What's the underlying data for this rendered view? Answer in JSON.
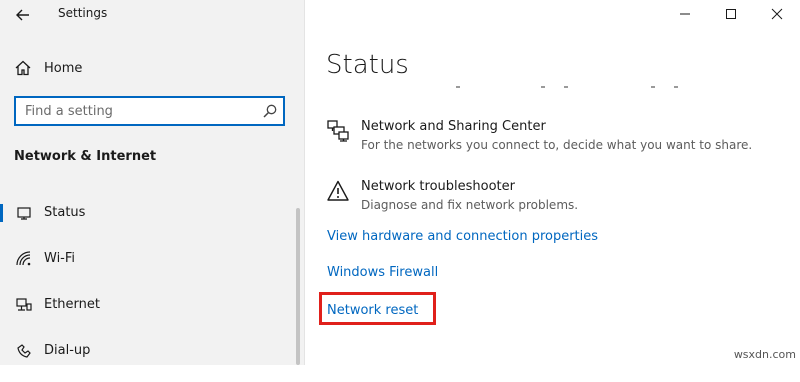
{
  "window": {
    "title": "Settings",
    "controls": {
      "minimize": "—",
      "maximize": "☐",
      "close": "✕"
    }
  },
  "sidebar": {
    "home_label": "Home",
    "search": {
      "placeholder": "Find a setting",
      "value": ""
    },
    "section_heading": "Network & Internet",
    "items": [
      {
        "label": "Status",
        "icon": "status-icon",
        "selected": true
      },
      {
        "label": "Wi-Fi",
        "icon": "wifi-icon",
        "selected": false
      },
      {
        "label": "Ethernet",
        "icon": "ethernet-icon",
        "selected": false
      },
      {
        "label": "Dial-up",
        "icon": "dialup-icon",
        "selected": false
      }
    ]
  },
  "main": {
    "title": "Status",
    "items": [
      {
        "title": "Network and Sharing Center",
        "description": "For the networks you connect to, decide what you want to share.",
        "icon": "sharing-center-icon"
      },
      {
        "title": "Network troubleshooter",
        "description": "Diagnose and fix network problems.",
        "icon": "warning-icon"
      }
    ],
    "links": [
      "View hardware and connection properties",
      "Windows Firewall",
      "Network reset"
    ]
  },
  "watermark": "wsxdn.com",
  "colors": {
    "accent": "#0067c0",
    "highlight": "#e0201b",
    "sidebar_bg": "#f2f2f2"
  }
}
